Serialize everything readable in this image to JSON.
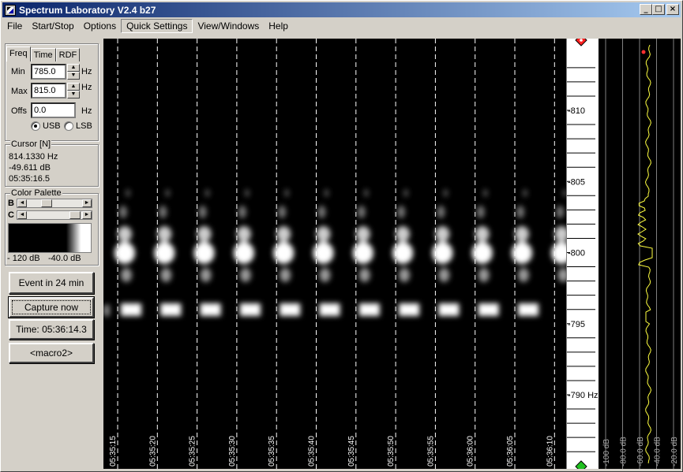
{
  "window": {
    "title": "Spectrum Laboratory V2.4 b27",
    "buttons": [
      "_",
      "□",
      "×"
    ]
  },
  "menu": [
    "File",
    "Start/Stop",
    "Options",
    "Quick Settings",
    "View/Windows",
    "Help"
  ],
  "tabs": [
    "Freq",
    "Time",
    "RDF"
  ],
  "freq": {
    "min_label": "Min",
    "min_value": "785.0",
    "max_label": "Max",
    "max_value": "815.0",
    "offs_label": "Offs",
    "offs_value": "0.0",
    "unit": "Hz",
    "usb_label": "USB",
    "lsb_label": "LSB",
    "selected": "USB"
  },
  "cursor": {
    "title": "Cursor [N]",
    "freq": "814.1330 Hz",
    "level": "-49.611 dB",
    "time": "05:35:16.5"
  },
  "palette": {
    "title": "Color Palette",
    "b_label": "B",
    "c_label": "C",
    "low": "- 120 dB",
    "high": "-40.0 dB"
  },
  "buttons": {
    "event": "Event in 24 min",
    "capture": "Capture now",
    "time": "Time:  05:36:14.3",
    "macro": "<macro2>"
  },
  "waterfall": {
    "time_labels": [
      "05:35:15",
      "05:35:20",
      "05:35:25",
      "05:35:30",
      "05:35:35",
      "05:35:40",
      "05:35:45",
      "05:35:50",
      "05:35:55",
      "05:36:00",
      "05:36:05",
      "05:36:10"
    ],
    "freq_labels": [
      "810",
      "805",
      "800",
      "795",
      "790 Hz"
    ],
    "spectrum_labels": [
      "-100 dB",
      "-80.0 dB",
      "-60.0 dB",
      "-40.0 dB",
      "-20.0 dB"
    ]
  },
  "colors": {
    "title_start": "#0a246a",
    "title_end": "#a6caf0",
    "trace": "#ffff40"
  }
}
